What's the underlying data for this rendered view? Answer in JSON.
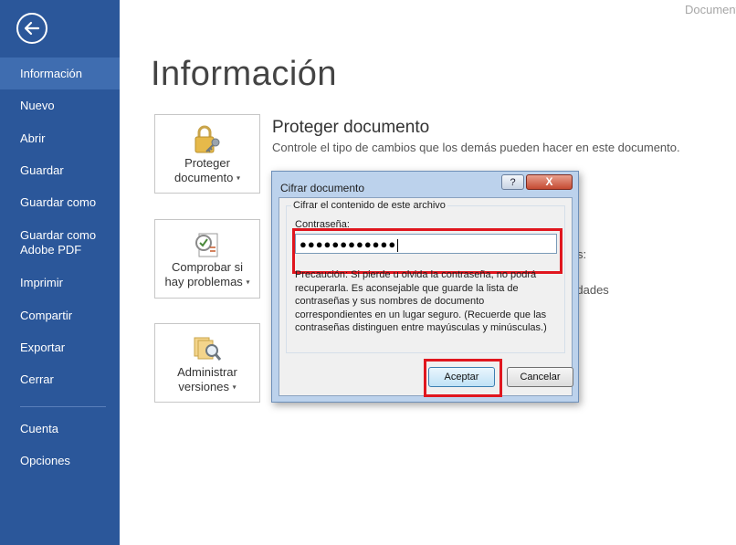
{
  "window": {
    "title_partial": "Document"
  },
  "sidebar": {
    "items": [
      {
        "label": "Información",
        "selected": true
      },
      {
        "label": "Nuevo"
      },
      {
        "label": "Abrir"
      },
      {
        "label": "Guardar"
      },
      {
        "label": "Guardar como"
      },
      {
        "label_line1": "Guardar como",
        "label_line2": "Adobe PDF"
      },
      {
        "label": "Imprimir"
      },
      {
        "label": "Compartir"
      },
      {
        "label": "Exportar"
      },
      {
        "label": "Cerrar"
      },
      {
        "label": "Cuenta"
      },
      {
        "label": "Opciones"
      }
    ]
  },
  "main": {
    "title": "Información",
    "cards": [
      {
        "line1": "Proteger",
        "line2": "documento",
        "icon": "lock-key-icon"
      },
      {
        "line1": "Comprobar si",
        "line2": "hay problemas",
        "icon": "checklist-icon"
      },
      {
        "line1": "Administrar",
        "line2": "versiones",
        "icon": "versions-magnifier-icon"
      }
    ],
    "protect_section": {
      "title": "Proteger documento",
      "description": "Controle el tipo de cambios que los demás pueden hacer en este documento."
    },
    "obscured_text_1": "s:",
    "obscured_text_2": "cidades"
  },
  "dialog": {
    "title": "Cifrar documento",
    "help_label": "?",
    "close_label": "X",
    "group_label": "Cifrar el contenido de este archivo",
    "password_label_access": "C",
    "password_label_rest": "ontraseña:",
    "password_value": "●●●●●●●●●●●●",
    "warning": "Precaución: Si pierde u olvida la contraseña, no podrá recuperarla. Es aconsejable que guarde la lista de contraseñas y sus nombres de documento correspondientes en un lugar seguro. (Recuerde que las contraseñas distinguen entre mayúsculas y minúsculas.)",
    "ok_label": "Aceptar",
    "cancel_label": "Cancelar"
  },
  "colors": {
    "sidebar": "#2b579a",
    "sidebar_selected": "#3f6db0",
    "highlight": "#e0161e"
  }
}
